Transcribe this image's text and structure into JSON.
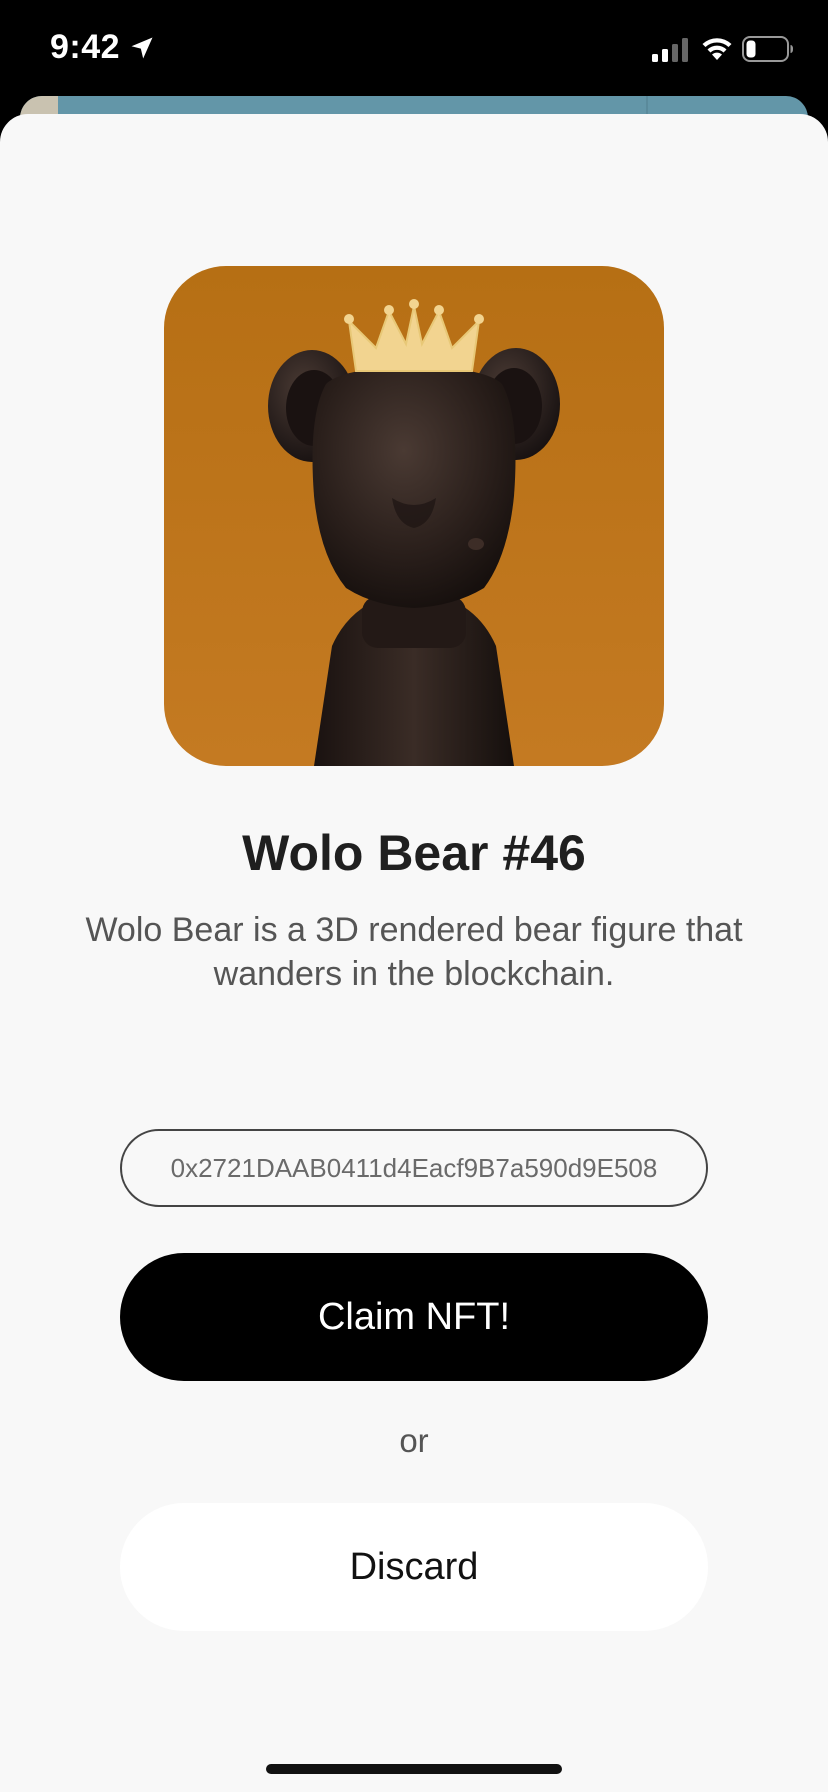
{
  "status_bar": {
    "time": "9:42",
    "icons": [
      "location-arrow-icon",
      "cellular-signal-icon",
      "wifi-icon",
      "battery-icon"
    ]
  },
  "nft": {
    "image_description": "wolo-bear-artwork",
    "title": "Wolo Bear #46",
    "description": "Wolo Bear is a 3D rendered bear figure that wanders in the blockchain."
  },
  "wallet": {
    "address": "0x2721DAAB0411d4Eacf9B7a590d9E508"
  },
  "actions": {
    "claim_label": "Claim NFT!",
    "separator": "or",
    "discard_label": "Discard"
  },
  "colors": {
    "image_background": "#c27a1c",
    "claim_button": "#000000",
    "sheet_background": "#f8f8f8",
    "behind_card": "#6396a8"
  }
}
